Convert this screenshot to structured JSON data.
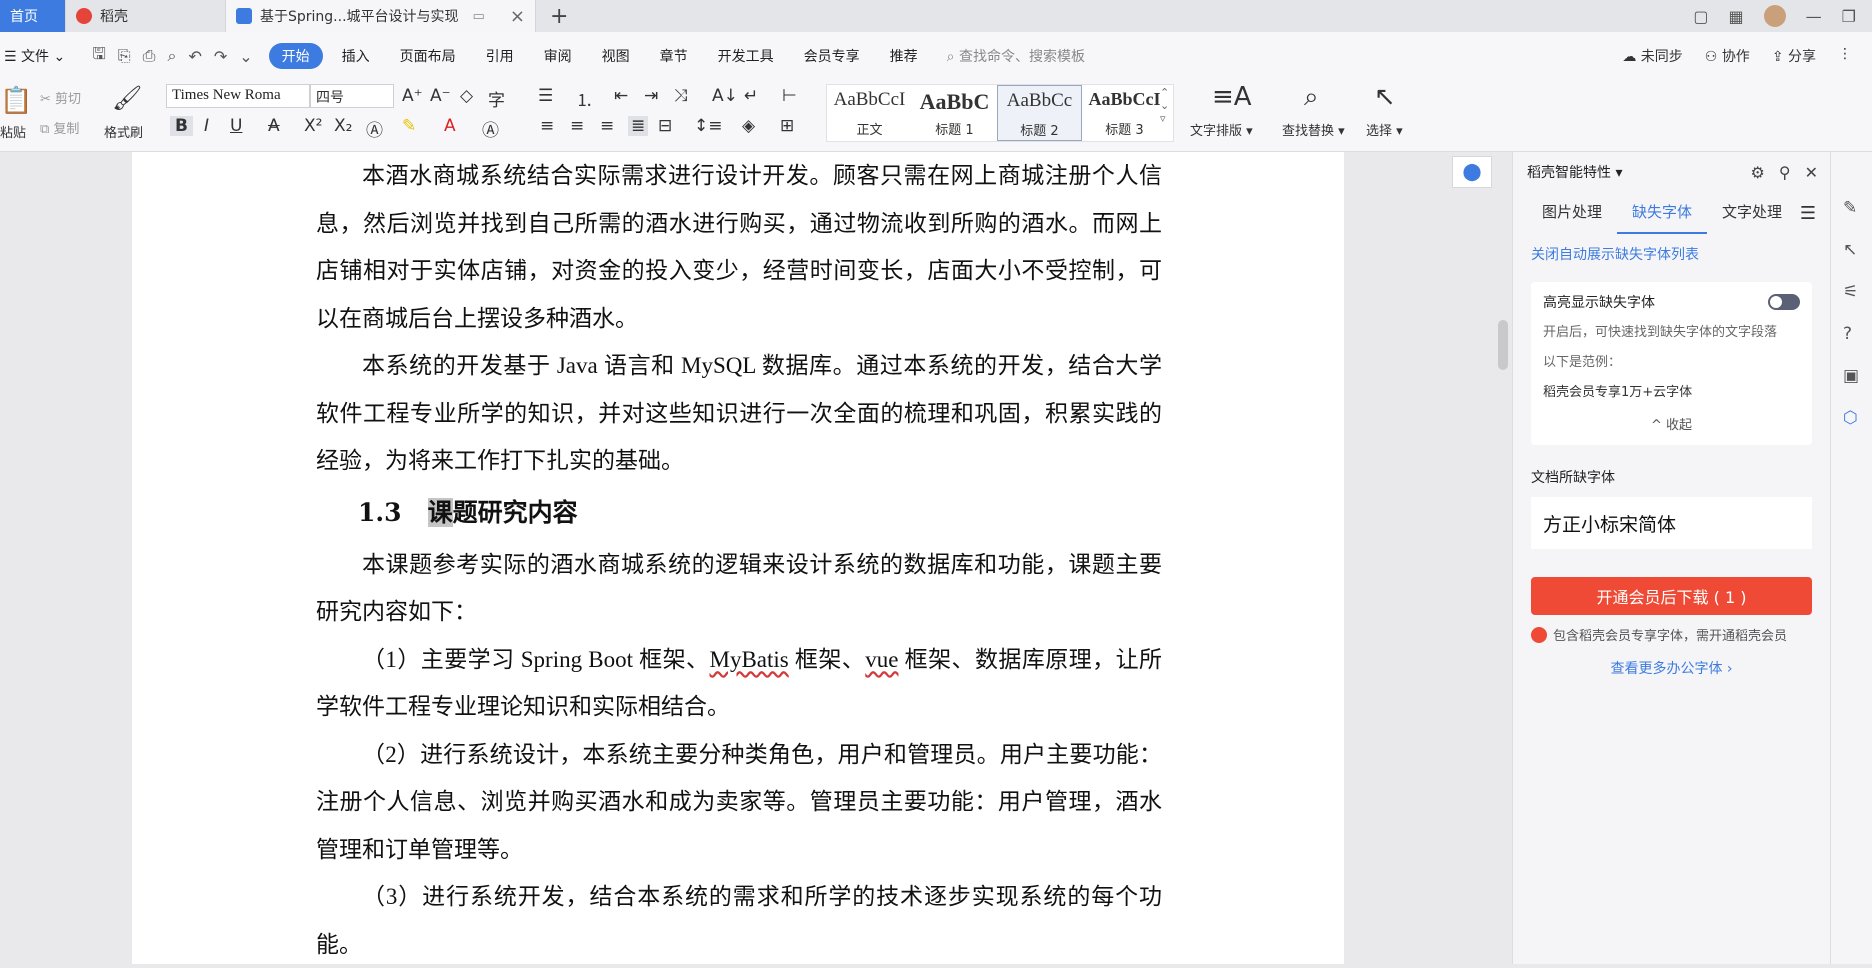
{
  "tabs": [
    {
      "label": "首页",
      "active": false
    },
    {
      "label": "稻壳",
      "active": false
    },
    {
      "label": "基于Spring...城平台设计与实现",
      "active": true
    }
  ],
  "menu": {
    "file": "文件",
    "items": [
      "开始",
      "插入",
      "页面布局",
      "引用",
      "审阅",
      "视图",
      "章节",
      "开发工具",
      "会员专享",
      "推荐"
    ],
    "active": "开始",
    "search_placeholder": "查找命令、搜索模板",
    "right": [
      "未同步",
      "协作",
      "分享"
    ]
  },
  "ribbon": {
    "cut": "剪切",
    "copy": "复制",
    "paste": "粘贴",
    "format_painter": "格式刷",
    "font_name": "Times New Roma",
    "font_size": "四号",
    "styles": [
      {
        "sample": "AaBbCcI",
        "name": "正文"
      },
      {
        "sample": "AaBbC",
        "name": "标题 1"
      },
      {
        "sample": "AaBbCc",
        "name": "标题 2"
      },
      {
        "sample": "AaBbCcI",
        "name": "标题 3"
      }
    ],
    "text_layout": "文字排版",
    "find_replace": "查找替换",
    "select": "选择"
  },
  "document": {
    "p1": "本酒水商城系统结合实际需求进行设计开发。顾客只需在网上商城注册个人信息，然后浏览并找到自己所需的酒水进行购买，通过物流收到所购的酒水。而网上店铺相对于实体店铺，对资金的投入变少，经营时间变长，店面大小不受控制，可以在商城后台上摆设多种酒水。",
    "p2": "本系统的开发基于 Java 语言和 MySQL 数据库。通过本系统的开发，结合大学软件工程专业所学的知识，并对这些知识进行一次全面的梳理和巩固，积累实践的经验，为将来工作打下扎实的基础。",
    "heading_num": "1.3",
    "heading_hl": "课",
    "heading_rest": "题研究内容",
    "p3": "本课题参考实际的酒水商城系统的逻辑来设计系统的数据库和功能，课题主要研究内容如下：",
    "p4_a": "（1）主要学习 Spring Boot 框架、",
    "p4_mybatis": "MyBatis",
    "p4_b": " 框架、",
    "p4_vue": "vue",
    "p4_c": " 框架、数据库原理，让所学软件工程专业理论知识和实际相结合。",
    "p5": "（2）进行系统设计，本系统主要分种类角色，用户和管理员。用户主要功能：注册个人信息、浏览并购买酒水和成为卖家等。管理员主要功能：用户管理，酒水管理和订单管理等。",
    "p6": "（3）进行系统开发，结合本系统的需求和所学的技术逐步实现系统的每个功能。"
  },
  "panel": {
    "title": "稻壳智能特性",
    "tabs": [
      "图片处理",
      "缺失字体",
      "文字处理"
    ],
    "active_tab": "缺失字体",
    "link": "关闭自动展示缺失字体列表",
    "card_title": "高亮显示缺失字体",
    "card_desc1": "开启后，可快速找到缺失字体的文字段落",
    "card_desc2": "以下是范例：",
    "card_example": "稻壳会员专享1万+云字体",
    "collapse": "收起",
    "missing_title": "文档所缺字体",
    "missing_font": "方正小标宋简体",
    "download_btn": "开通会员后下载 ( 1 )",
    "note": "包含稻壳会员专享字体，需开通稻壳会员",
    "more": "查看更多办公字体 ›"
  },
  "colors": {
    "accent": "#3d7be0",
    "download": "#ee4a36"
  }
}
